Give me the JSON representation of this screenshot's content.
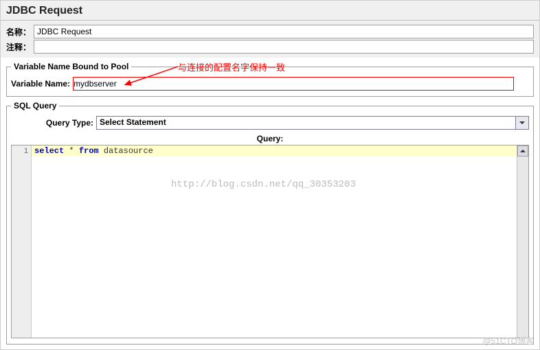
{
  "header": {
    "title": "JDBC Request"
  },
  "fields": {
    "name_label": "名称：",
    "name_value": "JDBC Request",
    "comment_label": "注释：",
    "comment_value": ""
  },
  "var_pool": {
    "legend": "Variable Name Bound to Pool",
    "label": "Variable Name:",
    "value": "mydbserver"
  },
  "sql": {
    "legend": "SQL Query",
    "query_type_label": "Query Type:",
    "query_type_value": "Select Statement",
    "query_label": "Query:",
    "line_no": "1",
    "kw_select": "select",
    "star": " * ",
    "kw_from": "from",
    "table": " datasource"
  },
  "annotation": {
    "text": "与连接的配置名字保持一致"
  },
  "watermark": {
    "text": "http://blog.csdn.net/qq_30353203"
  },
  "footer": {
    "text": "@51CTO博客"
  }
}
